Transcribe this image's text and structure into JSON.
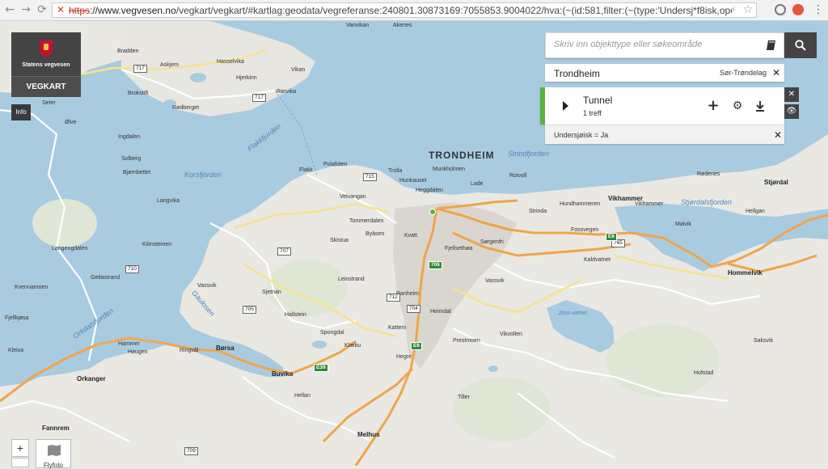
{
  "browser": {
    "url_scheme": "https",
    "url_host": "://www.vegvesen.no",
    "url_rest": "/vegkart/vegkart/#kartlag:geodata/vegreferanse:240801.30873169:7055853.9004022/hva:(~(id:581,filter:(~(type:'Undersj*f8isk,operator:'*3d,verdi:(~'..."
  },
  "app": {
    "logo_text": "Statens vegvesen",
    "title": "VEGKART",
    "info_label": "Info"
  },
  "search": {
    "placeholder": "Skriv inn objekttype eller søkeområde",
    "value": ""
  },
  "location": {
    "place": "Trondheim",
    "region": "Sør-Trøndelag"
  },
  "layer": {
    "name": "Tunnel",
    "count": "1 treff",
    "color": "#57b33e",
    "filter": "Undersjøisk = Ja"
  },
  "controls": {
    "zoom_in": "+",
    "basemap_label": "Flyfoto"
  },
  "map": {
    "city": "TRONDHEIM",
    "towns": [
      "Børsa",
      "Buvika",
      "Melhus",
      "Vikhammer",
      "Hommelvik",
      "Stjørdal",
      "Orkanger",
      "Fannrem"
    ],
    "water": [
      "Korsfjorden",
      "Flakkfjorden",
      "Strindfjorden",
      "Stjørdalsfjorden",
      "Gaulosen",
      "Orkdalsfjorden",
      "Jons-vatnet"
    ],
    "places": [
      "Vanvikan",
      "Akenes",
      "Bradden",
      "Vikan",
      "Askjem",
      "Rørvika",
      "Hjerkinn",
      "Hasselvika",
      "Brokstift",
      "Rødberget",
      "Seter",
      "Ølve",
      "Ingdalen",
      "Solberg",
      "Bjørnbettet",
      "Langvika",
      "Kilmsteinen",
      "Langengdalen",
      "Geitastrand",
      "Kvennamoen",
      "Fjellkjøsa",
      "Kleiva",
      "Vassvik",
      "Flakk",
      "Polafoten",
      "Trolla",
      "Munkholmen",
      "Hunkauset",
      "Heggdalen",
      "Lade",
      "Rotvoll",
      "Hundhammeren",
      "Fossvegen",
      "Vikhammer",
      "Malvik",
      "Hellgan",
      "Rødenes",
      "Velvangan",
      "Tommerdalen",
      "Skistua",
      "Byåsen",
      "Fjellsethøa",
      "Sørgenfri",
      "Strinda",
      "Ranheim",
      "Kattem",
      "Heimdal",
      "Tiller",
      "Klæbu",
      "Leinstrand",
      "Hallstein",
      "Spongdal",
      "Ringvål",
      "Hammer",
      "Haugen",
      "Sjetnan",
      "Vassvik",
      "Saksvik",
      "Hofstad",
      "Hellan",
      "Hegre",
      "Prestmoen",
      "Vikvollen",
      "Kvatt",
      "Kaldvatnet",
      "Stavne",
      "Solemsvåttan"
    ],
    "road_numbers": [
      "717",
      "715",
      "707",
      "710",
      "705",
      "709",
      "712",
      "704",
      "765",
      "E6",
      "E39",
      "706"
    ]
  }
}
